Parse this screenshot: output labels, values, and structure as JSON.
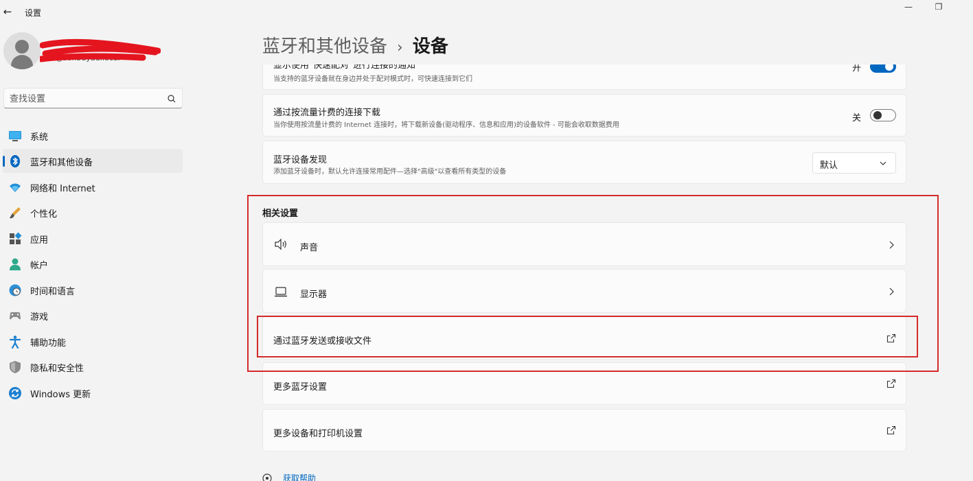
{
  "window": {
    "title": "设置",
    "back_glyph": "←",
    "minimize_glyph": "—",
    "maximize_glyph": "❐"
  },
  "profile": {
    "email": "…@sonbuyad.local"
  },
  "search": {
    "placeholder": "查找设置"
  },
  "nav": {
    "items": [
      {
        "label": "系统",
        "icon": "monitor-icon"
      },
      {
        "label": "蓝牙和其他设备",
        "icon": "bluetooth-icon",
        "active": true
      },
      {
        "label": "网络和 Internet",
        "icon": "wifi-icon"
      },
      {
        "label": "个性化",
        "icon": "brush-icon"
      },
      {
        "label": "应用",
        "icon": "apps-icon"
      },
      {
        "label": "帐户",
        "icon": "account-icon"
      },
      {
        "label": "时间和语言",
        "icon": "globe-clock-icon"
      },
      {
        "label": "游戏",
        "icon": "gamepad-icon"
      },
      {
        "label": "辅助功能",
        "icon": "accessibility-icon"
      },
      {
        "label": "隐私和安全性",
        "icon": "shield-icon"
      },
      {
        "label": "Windows 更新",
        "icon": "update-icon"
      }
    ],
    "accent_color": "#0067c0"
  },
  "header": {
    "parent": "蓝牙和其他设备",
    "separator": "›",
    "current": "设备"
  },
  "settings": {
    "swift_pair": {
      "title": "显示使用\"快速配对\"进行连接的通知",
      "desc": "当支持的蓝牙设备就在身边并处于配对模式时，可快速连接到它们",
      "state_label": "开",
      "on": true
    },
    "metered": {
      "title": "通过按流量计费的连接下载",
      "desc": "当你使用按流量计费的 Internet 连接时，将下载新设备(驱动程序、信息和应用)的设备软件 - 可能会收取数据费用",
      "state_label": "关",
      "on": false
    },
    "discovery": {
      "title": "蓝牙设备发现",
      "desc": "添加蓝牙设备时，默认允许连接常用配件—选择\"高级\"以查看所有类型的设备",
      "value": "默认"
    }
  },
  "related": {
    "section_title": "相关设置",
    "items": [
      {
        "label": "声音",
        "icon": "speaker-icon",
        "action": "chevron"
      },
      {
        "label": "显示器",
        "icon": "laptop-icon",
        "action": "chevron"
      },
      {
        "label": "通过蓝牙发送或接收文件",
        "action": "external"
      },
      {
        "label": "更多蓝牙设置",
        "action": "external"
      },
      {
        "label": "更多设备和打印机设置",
        "action": "external"
      }
    ]
  },
  "help": {
    "label": "获取帮助"
  },
  "colors": {
    "accent": "#0067c0",
    "annotation": "#d42a2a",
    "redaction": "#e4151f"
  }
}
